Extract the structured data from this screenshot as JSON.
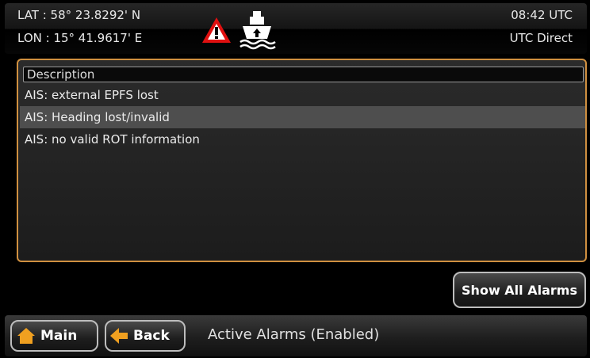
{
  "header": {
    "lat": "LAT : 58° 23.8292' N",
    "lon": "LON : 15° 41.9617' E",
    "time": "08:42 UTC",
    "time_source": "UTC Direct",
    "icons": [
      "warning-icon",
      "ship-transmit-icon"
    ]
  },
  "alarms": {
    "column_header": "Description",
    "items": [
      {
        "label": "AIS: external EPFS lost",
        "selected": false
      },
      {
        "label": "AIS: Heading lost/invalid",
        "selected": true
      },
      {
        "label": "AIS: no valid ROT information",
        "selected": false
      }
    ]
  },
  "buttons": {
    "show_all": "Show All Alarms",
    "main": "Main",
    "back": "Back"
  },
  "status": "Active Alarms (Enabled)",
  "colors": {
    "panel_border": "#d09040",
    "warning_red": "#e01010",
    "selected_row": "#4e4e4e",
    "nav_orange": "#f0a020"
  }
}
